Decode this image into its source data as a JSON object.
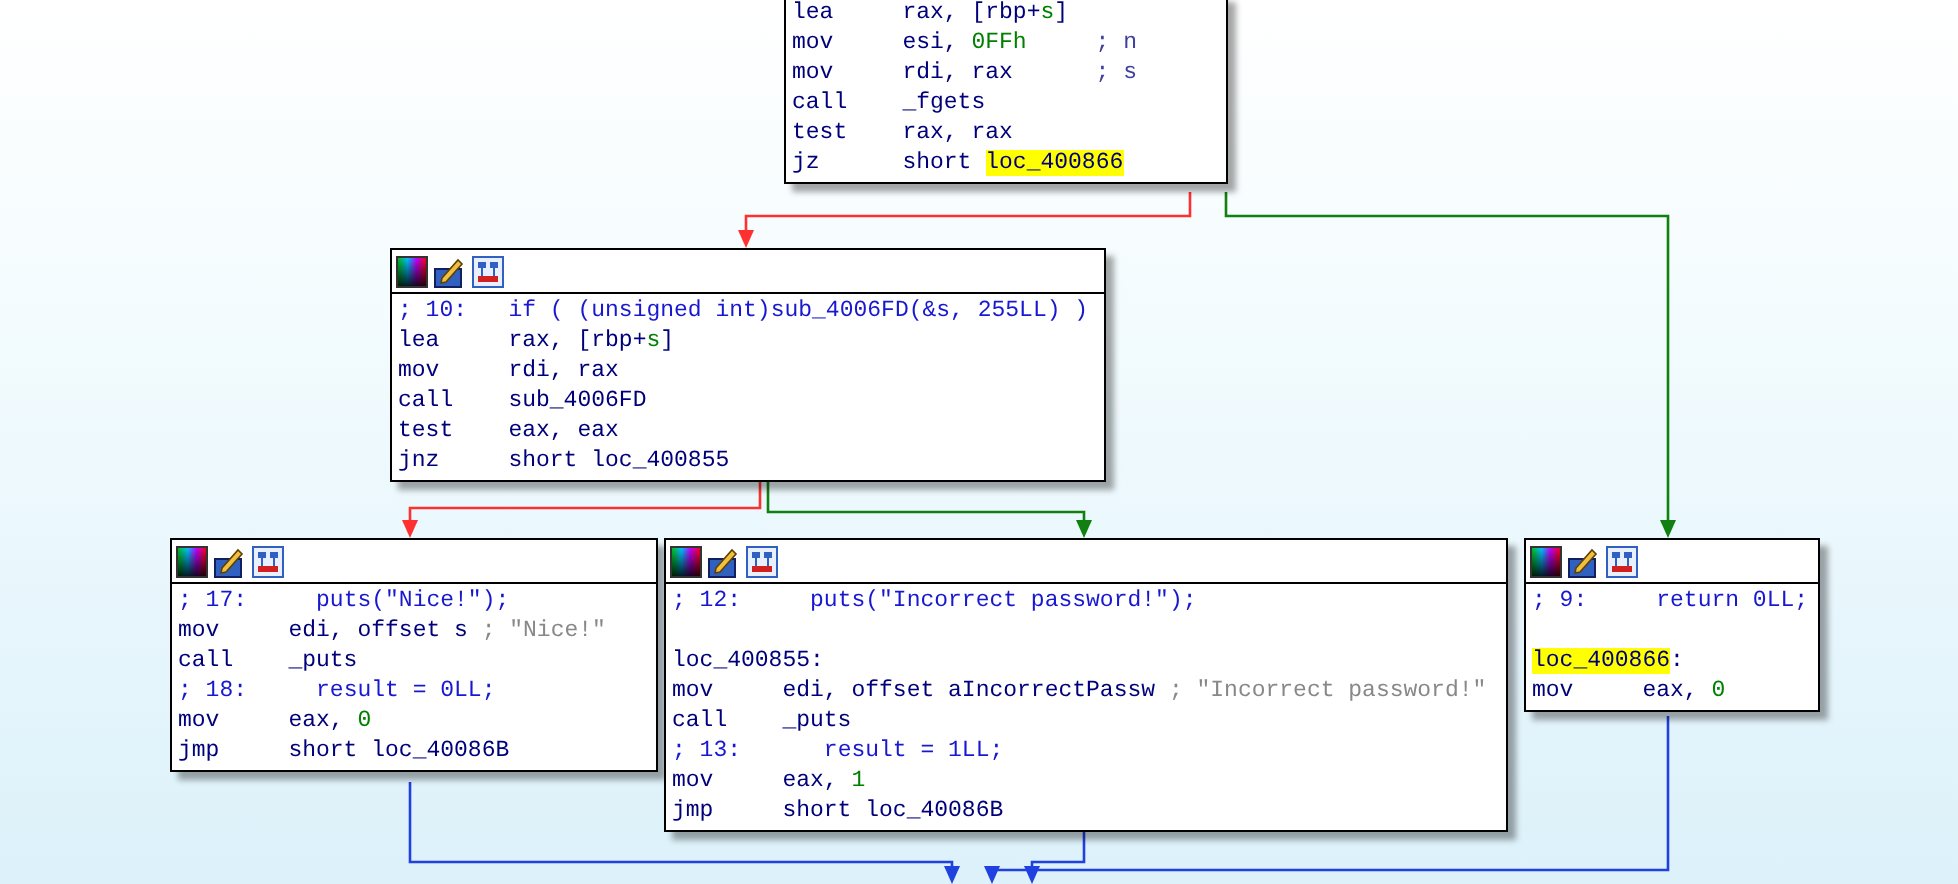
{
  "nodes": [
    {
      "toolbar": false,
      "lines": [
        {
          "kind": "instruction",
          "mnemonic": "lea",
          "operands": [
            {
              "text": "rax, [rbp+",
              "kind": "text"
            },
            {
              "text": "s",
              "kind": "var"
            },
            {
              "text": "]",
              "kind": "text"
            }
          ]
        },
        {
          "kind": "instruction",
          "mnemonic": "mov",
          "operands": [
            {
              "text": "esi, ",
              "kind": "text"
            },
            {
              "text": "0FFh",
              "kind": "number"
            }
          ],
          "comment": {
            "text": "; n",
            "kind": "comment"
          }
        },
        {
          "kind": "instruction",
          "mnemonic": "mov",
          "operands": [
            {
              "text": "rdi, rax",
              "kind": "text"
            }
          ],
          "comment": {
            "text": "; s",
            "kind": "comment"
          }
        },
        {
          "kind": "instruction",
          "mnemonic": "call",
          "operands": [
            {
              "text": "_fgets",
              "kind": "text"
            }
          ]
        },
        {
          "kind": "instruction",
          "mnemonic": "test",
          "operands": [
            {
              "text": "rax, rax",
              "kind": "text"
            }
          ]
        },
        {
          "kind": "instruction",
          "mnemonic": "jz",
          "operands": [
            {
              "text": "short ",
              "kind": "text"
            },
            {
              "text": "loc_400866",
              "kind": "highlight"
            }
          ]
        }
      ]
    },
    {
      "toolbar": true,
      "lines": [
        {
          "kind": "pseudo",
          "text": "; 10:   if ( (unsigned int)sub_4006FD(&s, 255LL) )"
        },
        {
          "kind": "instruction",
          "mnemonic": "lea",
          "operands": [
            {
              "text": "rax, [rbp+",
              "kind": "text"
            },
            {
              "text": "s",
              "kind": "var"
            },
            {
              "text": "]",
              "kind": "text"
            }
          ]
        },
        {
          "kind": "instruction",
          "mnemonic": "mov",
          "operands": [
            {
              "text": "rdi, rax",
              "kind": "text"
            }
          ]
        },
        {
          "kind": "instruction",
          "mnemonic": "call",
          "operands": [
            {
              "text": "sub_4006FD",
              "kind": "text"
            }
          ]
        },
        {
          "kind": "instruction",
          "mnemonic": "test",
          "operands": [
            {
              "text": "eax, eax",
              "kind": "text"
            }
          ]
        },
        {
          "kind": "instruction",
          "mnemonic": "jnz",
          "operands": [
            {
              "text": "short loc_400855",
              "kind": "text"
            }
          ]
        }
      ]
    },
    {
      "toolbar": true,
      "lines": [
        {
          "kind": "pseudo",
          "text": "; 17:     puts(\"Nice!\");"
        },
        {
          "kind": "instruction",
          "mnemonic": "mov",
          "operands": [
            {
              "text": "edi, offset s",
              "kind": "text"
            }
          ],
          "comment": {
            "text": "; \"Nice!\"",
            "kind": "string"
          }
        },
        {
          "kind": "instruction",
          "mnemonic": "call",
          "operands": [
            {
              "text": "_puts",
              "kind": "text"
            }
          ]
        },
        {
          "kind": "pseudo",
          "text": "; 18:     result = 0LL;"
        },
        {
          "kind": "instruction",
          "mnemonic": "mov",
          "operands": [
            {
              "text": "eax, ",
              "kind": "text"
            },
            {
              "text": "0",
              "kind": "number"
            }
          ]
        },
        {
          "kind": "instruction",
          "mnemonic": "jmp",
          "operands": [
            {
              "text": "short loc_40086B",
              "kind": "text"
            }
          ]
        }
      ]
    },
    {
      "toolbar": true,
      "lines": [
        {
          "kind": "pseudo",
          "text": "; 12:     puts(\"Incorrect password!\");"
        },
        {
          "kind": "blank"
        },
        {
          "kind": "label",
          "parts": [
            {
              "text": "loc_400855",
              "kind": "text"
            },
            {
              "text": ":",
              "kind": "text"
            }
          ]
        },
        {
          "kind": "instruction",
          "mnemonic": "mov",
          "operands": [
            {
              "text": "edi, offset aIncorrectPassw",
              "kind": "text"
            }
          ],
          "comment": {
            "text": "; \"Incorrect password!\"",
            "kind": "string"
          }
        },
        {
          "kind": "instruction",
          "mnemonic": "call",
          "operands": [
            {
              "text": "_puts",
              "kind": "text"
            }
          ]
        },
        {
          "kind": "pseudo",
          "text": "; 13:      result = 1LL;"
        },
        {
          "kind": "instruction",
          "mnemonic": "mov",
          "operands": [
            {
              "text": "eax, ",
              "kind": "text"
            },
            {
              "text": "1",
              "kind": "number"
            }
          ]
        },
        {
          "kind": "instruction",
          "mnemonic": "jmp",
          "operands": [
            {
              "text": "short loc_40086B",
              "kind": "text"
            }
          ]
        }
      ]
    },
    {
      "toolbar": true,
      "lines": [
        {
          "kind": "pseudo",
          "text": "; 9:     return 0LL;"
        },
        {
          "kind": "blank"
        },
        {
          "kind": "label",
          "parts": [
            {
              "text": "loc_400866",
              "kind": "highlight"
            },
            {
              "text": ":",
              "kind": "text"
            }
          ]
        },
        {
          "kind": "instruction",
          "mnemonic": "mov",
          "operands": [
            {
              "text": "eax, ",
              "kind": "text"
            },
            {
              "text": "0",
              "kind": "number"
            }
          ]
        }
      ]
    }
  ],
  "edges": [
    {
      "kind": "false_branch"
    },
    {
      "kind": "true_branch"
    },
    {
      "kind": "false_branch"
    },
    {
      "kind": "true_branch"
    },
    {
      "kind": "jump"
    },
    {
      "kind": "jump"
    },
    {
      "kind": "jump"
    }
  ]
}
